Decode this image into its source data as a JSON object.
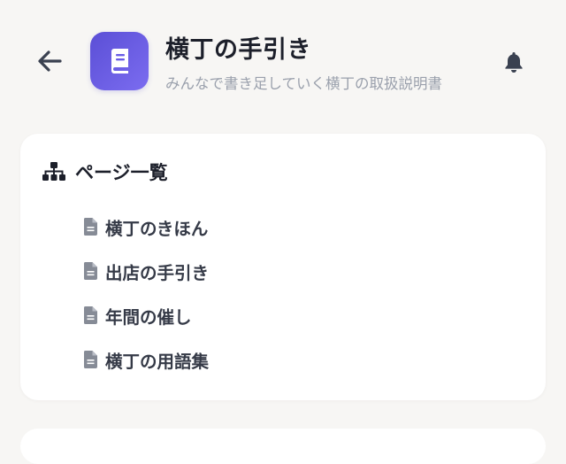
{
  "header": {
    "back_icon": "arrow-left-icon",
    "app_icon": "book-icon",
    "title": "横丁の手引き",
    "subtitle": "みんなで書き足していく横丁の取扱説明書",
    "bell_icon": "bell-icon",
    "accent_color": "#5b4fd6"
  },
  "page_list": {
    "icon": "sitemap-icon",
    "title": "ページ一覧",
    "items": [
      {
        "label": "横丁のきほん",
        "icon": "document-icon"
      },
      {
        "label": "出店の手引き",
        "icon": "document-icon"
      },
      {
        "label": "年間の催し",
        "icon": "document-icon"
      },
      {
        "label": "横丁の用語集",
        "icon": "document-icon"
      }
    ]
  }
}
